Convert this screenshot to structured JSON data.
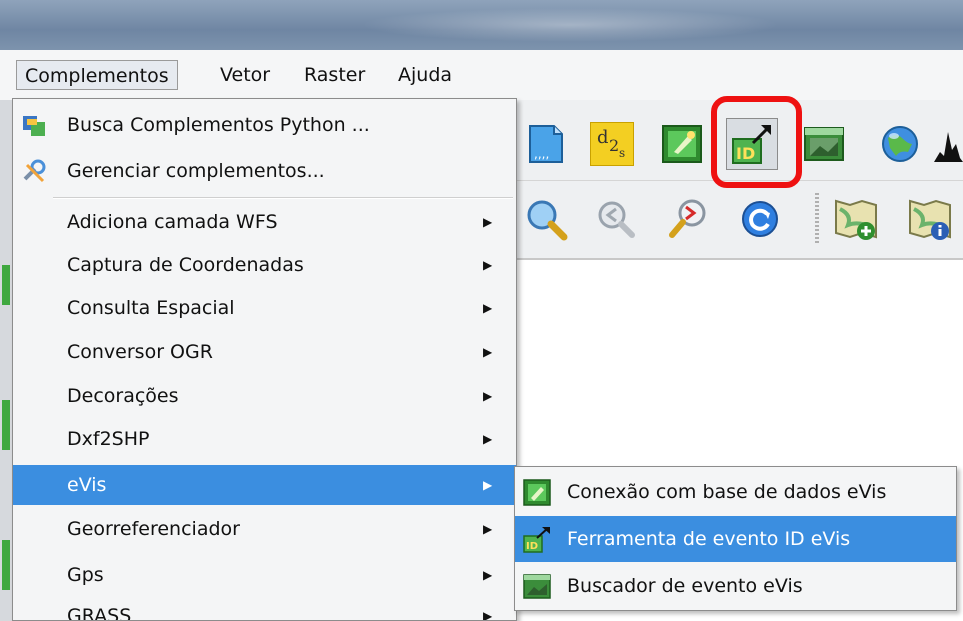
{
  "menubar": {
    "items": [
      {
        "label": "Complementos",
        "active": true
      },
      {
        "label": "Vetor"
      },
      {
        "label": "Raster"
      },
      {
        "label": "Ajuda"
      }
    ]
  },
  "toolbar1": {
    "icons": [
      "raster-file-icon",
      "d2s-icon",
      "evis-database-icon",
      "evis-event-id-icon",
      "evis-event-browser-icon",
      "globe-icon",
      "histogram-icon"
    ],
    "d2s_text": "d",
    "d2s_sub1": "2",
    "d2s_sub2": "s"
  },
  "toolbar2": {
    "icons": [
      "zoom-last-icon",
      "zoom-previous-icon",
      "zoom-next-icon",
      "refresh-icon",
      "new-map-icon",
      "map-info-icon"
    ]
  },
  "dropdown": {
    "items": [
      {
        "label": "Busca Complementos Python ...",
        "icon": "python-plugins-icon"
      },
      {
        "label": "Gerenciar complementos...",
        "icon": "manage-plugins-icon"
      },
      {
        "label": "Adiciona camada WFS",
        "submenu": true
      },
      {
        "label": "Captura de Coordenadas",
        "submenu": true
      },
      {
        "label": "Consulta Espacial",
        "submenu": true
      },
      {
        "label": "Conversor OGR",
        "submenu": true
      },
      {
        "label": "Decorações",
        "submenu": true
      },
      {
        "label": "Dxf2SHP",
        "submenu": true
      },
      {
        "label": "eVis",
        "submenu": true,
        "active": true
      },
      {
        "label": "Georreferenciador",
        "submenu": true
      },
      {
        "label": "Gps",
        "submenu": true
      },
      {
        "label": "GRASS",
        "submenu": true
      }
    ]
  },
  "submenu": {
    "items": [
      {
        "label": "Conexão com base de dados eVis",
        "icon": "evis-database-icon"
      },
      {
        "label": "Ferramenta de evento ID eVis",
        "icon": "evis-event-id-icon",
        "active": true
      },
      {
        "label": "Buscador de evento eVis",
        "icon": "evis-event-browser-icon"
      }
    ]
  },
  "colors": {
    "highlight": "#3b8ee0",
    "callout": "#ee1111"
  }
}
